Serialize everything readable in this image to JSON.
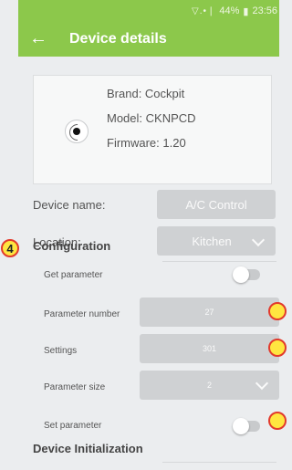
{
  "status": {
    "signal": "▽.•❘",
    "battery": "44%",
    "time": "23:56"
  },
  "header": {
    "title": "Device details"
  },
  "device": {
    "brand": "Brand: Cockpit",
    "model": "Model: CKNPCD",
    "firmware": "Firmware: 1.20"
  },
  "form": {
    "device_name_label": "Device name:",
    "device_name_value": "A/C Control",
    "location_label": "Location:",
    "location_value": "Kitchen"
  },
  "configuration": {
    "badge": "4",
    "title": "Configuration",
    "get_parameter_label": "Get parameter",
    "get_parameter_on": false,
    "parameter_number_label": "Parameter number",
    "parameter_number_value": "27",
    "settings_label": "Settings",
    "settings_value": "301",
    "parameter_size_label": "Parameter size",
    "parameter_size_value": "2",
    "set_parameter_label": "Set parameter",
    "set_parameter_on": false
  },
  "device_init": {
    "title": "Device Initialization"
  }
}
